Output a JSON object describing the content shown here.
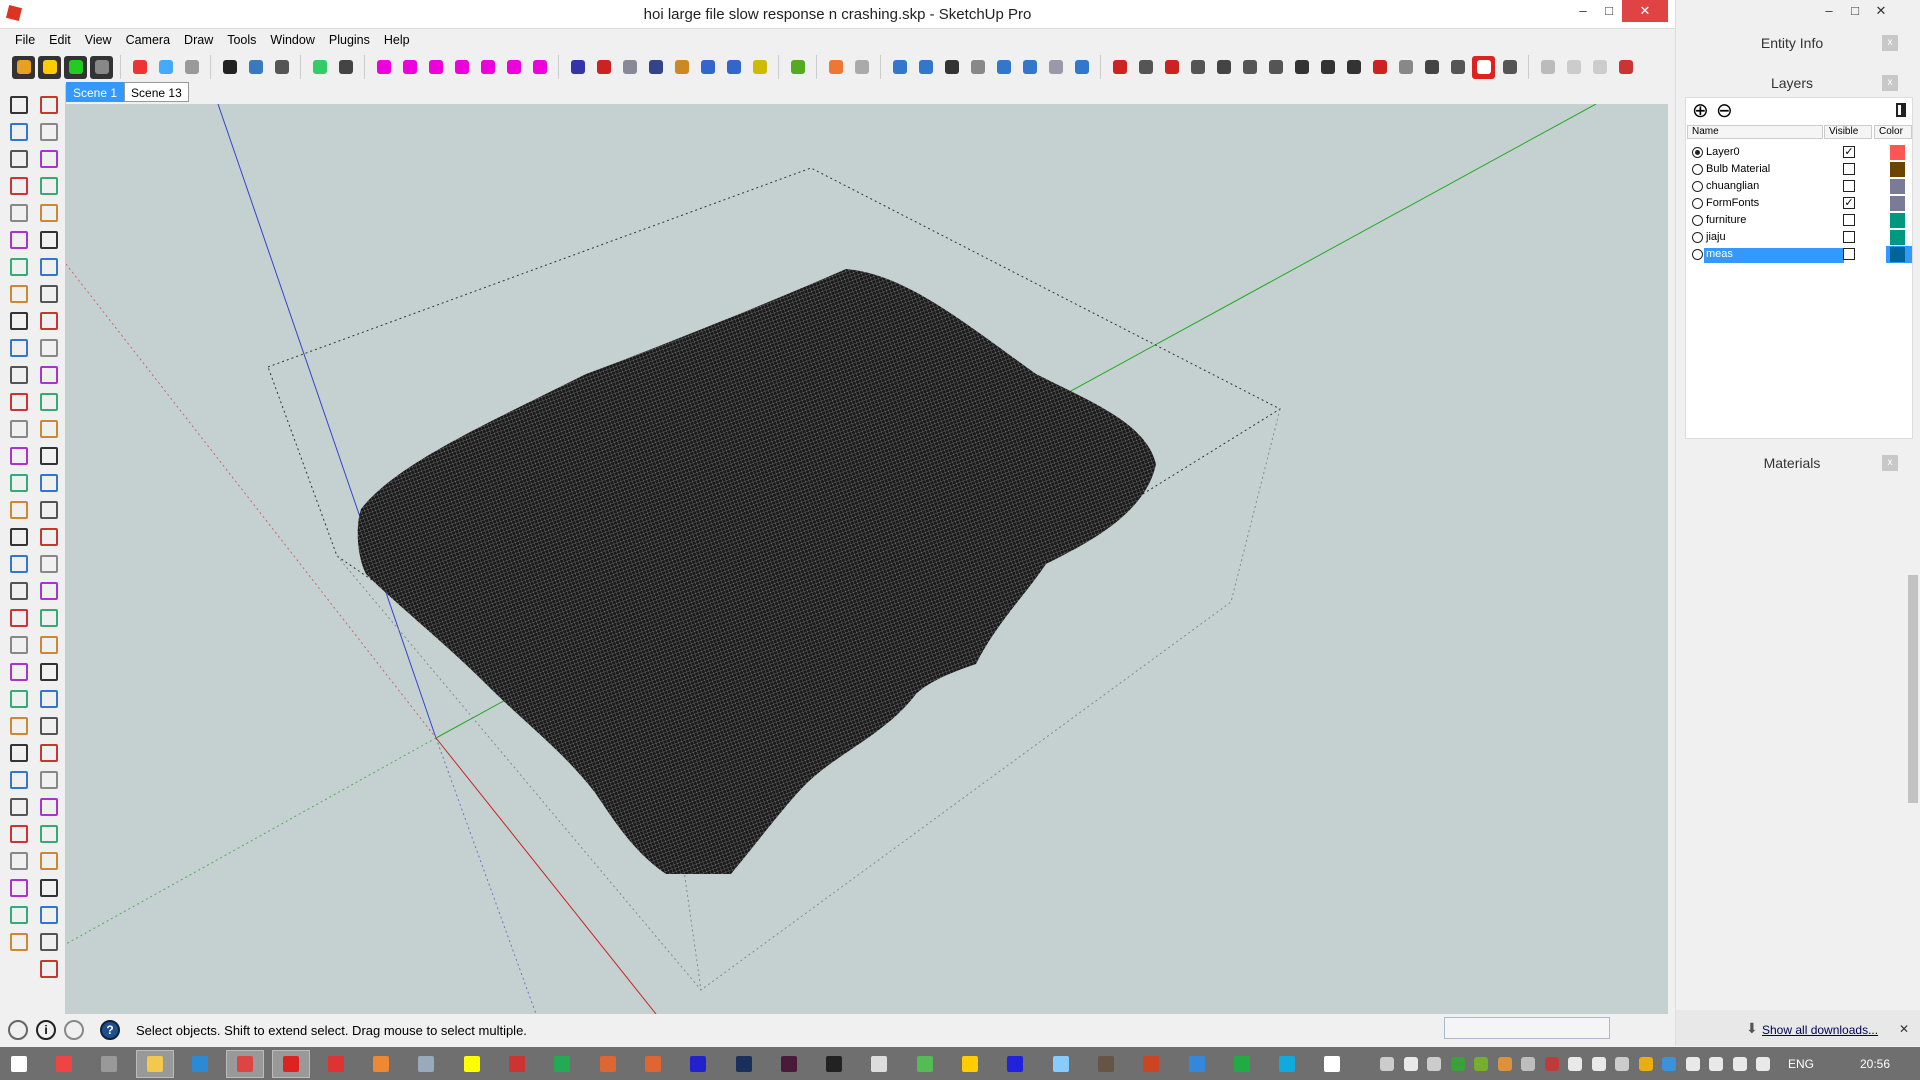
{
  "window": {
    "title": "hoi large file slow response n crashing.skp - SketchUp Pro",
    "minimize": "–",
    "maximize": "□",
    "close": "✕"
  },
  "menu": [
    "File",
    "Edit",
    "View",
    "Camera",
    "Draw",
    "Tools",
    "Window",
    "Plugins",
    "Help"
  ],
  "toolbar_icons": [
    {
      "name": "gear-icon",
      "color": "#e8a020",
      "bg": "#333"
    },
    {
      "name": "bulb-icon",
      "color": "#ffcc00",
      "bg": "#333"
    },
    {
      "name": "go-icon",
      "color": "#2c2",
      "bg": "#333"
    },
    {
      "name": "sliders-icon",
      "color": "#888",
      "bg": "#333"
    },
    "|",
    {
      "name": "red-box-icon",
      "color": "#e33"
    },
    {
      "name": "blue-box-icon",
      "color": "#4af"
    },
    {
      "name": "gray-box-icon",
      "color": "#999"
    },
    "|",
    {
      "name": "fullscreen-icon",
      "color": "#222"
    },
    {
      "name": "outliner-icon",
      "color": "#3a78c0"
    },
    {
      "name": "settings-icon",
      "color": "#555"
    },
    "|",
    {
      "name": "gradient-icon",
      "color": "#3c6"
    },
    {
      "name": "cursor-tool-icon",
      "color": "#444"
    },
    "|",
    {
      "name": "arc-tool-icon",
      "color": "#e0d"
    },
    {
      "name": "arc-tool-icon",
      "color": "#e0d"
    },
    {
      "name": "arc-tool-icon",
      "color": "#e0d"
    },
    {
      "name": "arc-tool-icon",
      "color": "#e0d"
    },
    {
      "name": "arc-tool-icon",
      "color": "#e0d"
    },
    {
      "name": "arc-tool-icon",
      "color": "#e0d"
    },
    {
      "name": "arc-tool-icon",
      "color": "#e0d"
    },
    "|",
    {
      "name": "fredo-icon",
      "color": "#33a"
    },
    {
      "name": "flip-icon",
      "color": "#c22"
    },
    {
      "name": "magnify-icon",
      "color": "#889"
    },
    {
      "name": "vertex-icon",
      "color": "#348"
    },
    {
      "name": "star-icon",
      "color": "#c82"
    },
    {
      "name": "line-icon",
      "color": "#36c"
    },
    {
      "name": "paint-icon",
      "color": "#36c"
    },
    {
      "name": "wand-icon",
      "color": "#cb0"
    },
    "|",
    {
      "name": "cube-green-icon",
      "color": "#5a2"
    },
    "|",
    {
      "name": "layers-icon",
      "color": "#e73"
    },
    {
      "name": "layers-gray-icon",
      "color": "#aaa"
    },
    "|",
    {
      "name": "play-icon",
      "color": "#37c"
    },
    {
      "name": "pause-icon",
      "color": "#37c"
    },
    {
      "name": "record-icon",
      "color": "#333"
    },
    {
      "name": "stop-icon",
      "color": "#888"
    },
    {
      "name": "settings-blue-icon",
      "color": "#37c"
    },
    {
      "name": "window-icon",
      "color": "#37c"
    },
    {
      "name": "window2-icon",
      "color": "#99a"
    },
    {
      "name": "help-icon",
      "color": "#37c"
    },
    "|",
    {
      "name": "truck-icon",
      "color": "#c22"
    },
    {
      "name": "doc-icon",
      "color": "#555"
    },
    {
      "name": "key-icon",
      "color": "#c22"
    },
    {
      "name": "wing-icon",
      "color": "#555"
    },
    {
      "name": "building-icon",
      "color": "#444"
    },
    {
      "name": "wall-icon",
      "color": "#555"
    },
    {
      "name": "column-icon",
      "color": "#555"
    },
    {
      "name": "beam-icon",
      "color": "#333"
    },
    {
      "name": "stair-icon",
      "color": "#333"
    },
    {
      "name": "stairs-icon",
      "color": "#333"
    },
    {
      "name": "gear-red-icon",
      "color": "#c22"
    },
    {
      "name": "grid-icon",
      "color": "#888"
    },
    {
      "name": "plane-icon",
      "color": "#444"
    },
    {
      "name": "box-icon",
      "color": "#555"
    },
    {
      "name": "bim-icon",
      "color": "#fff",
      "bg": "#d22"
    },
    {
      "name": "hand-icon",
      "color": "#555"
    },
    "|",
    {
      "name": "disabled-icon",
      "color": "#bbb"
    },
    {
      "name": "disabled-icon",
      "color": "#ccc"
    },
    {
      "name": "disabled-icon",
      "color": "#ccc"
    },
    {
      "name": "graph-icon",
      "color": "#c33"
    }
  ],
  "scenes": [
    "Scene 1",
    "Scene 13"
  ],
  "status": {
    "text": "Select objects. Shift to extend select. Drag mouse to select multiple.",
    "icons": [
      "geo-location-icon",
      "credits-icon",
      "user-icon",
      "help-icon"
    ]
  },
  "panels": {
    "entity_info": "Entity Info",
    "layers": {
      "title": "Layers",
      "add": "⊕",
      "remove": "⊖",
      "headers": {
        "name": "Name",
        "visible": "Visible",
        "color": "Color"
      },
      "rows": [
        {
          "name": "Layer0",
          "active": true,
          "visible": true,
          "color": "#ff5555"
        },
        {
          "name": "Bulb Material",
          "active": false,
          "visible": false,
          "color": "#6b4400"
        },
        {
          "name": "chuanglian",
          "active": false,
          "visible": false,
          "color": "#7a7a99"
        },
        {
          "name": "FormFonts",
          "active": false,
          "visible": true,
          "color": "#7a7a99"
        },
        {
          "name": "furniture",
          "active": false,
          "visible": false,
          "color": "#009980"
        },
        {
          "name": "jiaju",
          "active": false,
          "visible": false,
          "color": "#009980"
        },
        {
          "name": "meas",
          "active": false,
          "visible": false,
          "color": "#006699",
          "selected": true
        }
      ]
    },
    "materials": "Materials",
    "close": "x"
  },
  "downloads": {
    "link": "Show all downloads...",
    "close": "✕"
  },
  "taskbar": {
    "apps": [
      {
        "name": "start-icon",
        "color": "#fff"
      },
      {
        "name": "apps-icon",
        "color": "#e44"
      },
      {
        "name": "device-icon",
        "color": "#999"
      },
      {
        "name": "file-explorer-icon",
        "color": "#f2c94c",
        "active": true
      },
      {
        "name": "internet-explorer-icon",
        "color": "#2a8ad4"
      },
      {
        "name": "chrome-app-icon",
        "color": "#d44",
        "active": true
      },
      {
        "name": "sketchup-icon",
        "color": "#d22",
        "active": true
      },
      {
        "name": "layout-icon",
        "color": "#d33"
      },
      {
        "name": "blender-icon",
        "color": "#e83"
      },
      {
        "name": "app-icon",
        "color": "#9ab"
      },
      {
        "name": "bulb-app-icon",
        "color": "#ff0"
      },
      {
        "name": "app-red-icon",
        "color": "#c33"
      },
      {
        "name": "app-green-icon",
        "color": "#2a5"
      },
      {
        "name": "app-orange-icon",
        "color": "#d63"
      },
      {
        "name": "app-orange2-icon",
        "color": "#d63"
      },
      {
        "name": "ultraedit-icon",
        "color": "#22c"
      },
      {
        "name": "photoshop-icon",
        "color": "#1a2f5a"
      },
      {
        "name": "indesign-icon",
        "color": "#4a1a3a"
      },
      {
        "name": "unity-icon",
        "color": "#222"
      },
      {
        "name": "app-icon",
        "color": "#ddd"
      },
      {
        "name": "app-icon",
        "color": "#5b5"
      },
      {
        "name": "chrome-icon",
        "color": "#fc0"
      },
      {
        "name": "app-blue-icon",
        "color": "#22d"
      },
      {
        "name": "app-icon",
        "color": "#8cf"
      },
      {
        "name": "app-icon",
        "color": "#654"
      },
      {
        "name": "app-icon",
        "color": "#c42"
      },
      {
        "name": "app-icon",
        "color": "#38d"
      },
      {
        "name": "app-icon",
        "color": "#2a4"
      },
      {
        "name": "skype-icon",
        "color": "#1ad"
      },
      {
        "name": "chat-icon",
        "color": "#fff"
      }
    ],
    "tray": [
      "keyboard-icon",
      "chevron-up-icon",
      "bell-icon",
      "hangouts-icon",
      "nvidia-icon",
      "app-icon",
      "diamond-icon",
      "app-icon",
      "cloud-check-icon",
      "cloud-icon",
      "bird-icon",
      "google-drive-icon",
      "dropbox-icon",
      "flag-icon",
      "volume-icon",
      "battery-icon",
      "signal-icon"
    ],
    "tray_colors": [
      "#ddd",
      "#fff",
      "#ddd",
      "#3a3",
      "#7b2",
      "#e93",
      "#ccc",
      "#c33",
      "#fff",
      "#fff",
      "#ddd",
      "#fb0",
      "#39e",
      "#fff",
      "#fff",
      "#fff",
      "#fff"
    ],
    "lang": "ENG",
    "clock": "20:56"
  }
}
